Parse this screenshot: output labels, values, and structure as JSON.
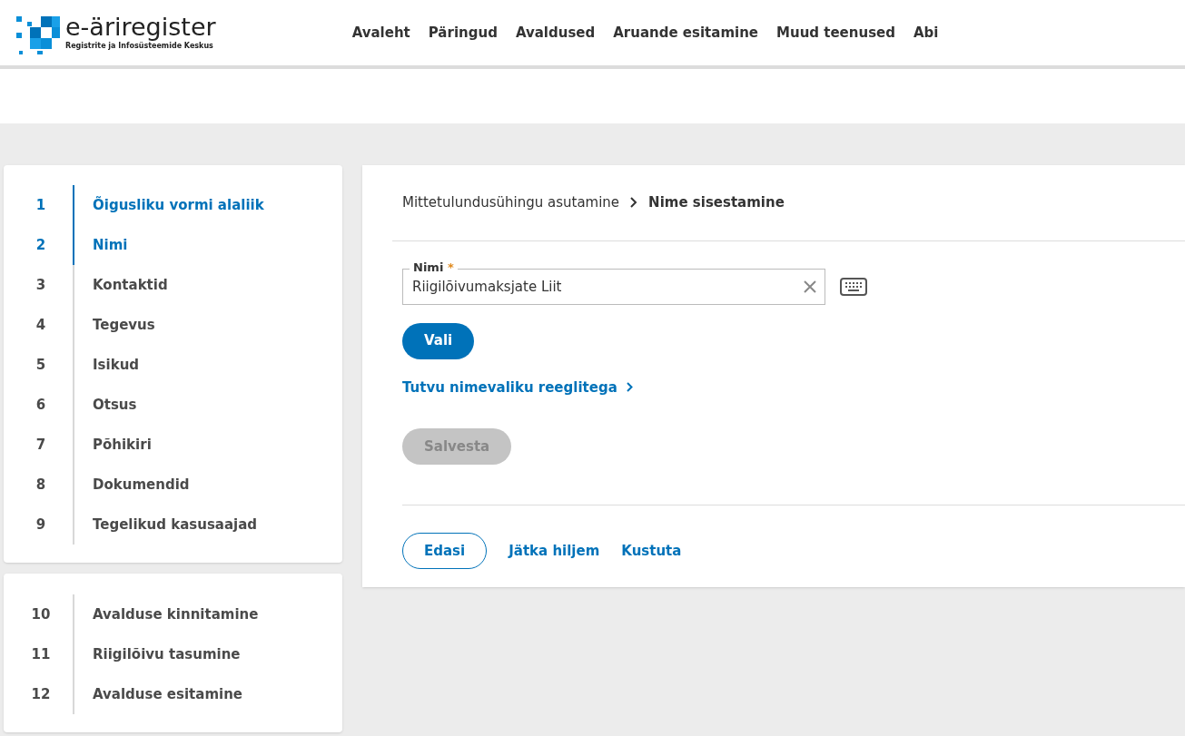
{
  "logo": {
    "name": "e-äriregister",
    "subtitle": "Registrite ja Infosüsteemide Keskus"
  },
  "nav": [
    "Avaleht",
    "Päringud",
    "Avaldused",
    "Aruande esitamine",
    "Muud teenused",
    "Abi"
  ],
  "steps": [
    {
      "number": "1",
      "label": "Õigusliku vormi alaliik",
      "highlighted": true
    },
    {
      "number": "2",
      "label": "Nimi",
      "highlighted": true
    },
    {
      "number": "3",
      "label": "Kontaktid",
      "highlighted": false
    },
    {
      "number": "4",
      "label": "Tegevus",
      "highlighted": false
    },
    {
      "number": "5",
      "label": "Isikud",
      "highlighted": false
    },
    {
      "number": "6",
      "label": "Otsus",
      "highlighted": false
    },
    {
      "number": "7",
      "label": "Põhikiri",
      "highlighted": false
    },
    {
      "number": "8",
      "label": "Dokumendid",
      "highlighted": false
    },
    {
      "number": "9",
      "label": "Tegelikud kasusaajad",
      "highlighted": false
    }
  ],
  "final_steps": [
    {
      "number": "10",
      "label": "Avalduse kinnitamine",
      "highlighted": false
    },
    {
      "number": "11",
      "label": "Riigilõivu tasumine",
      "highlighted": false
    },
    {
      "number": "12",
      "label": "Avalduse esitamine",
      "highlighted": false
    }
  ],
  "breadcrumb": [
    "Mittetulundusühingu asutamine",
    "Nime sisestamine"
  ],
  "name_field": {
    "label": "Nimi",
    "required_mark": "*",
    "value": "Riigilõivumaksjate Liit"
  },
  "select_button": {
    "label": "Vali",
    "disabled": false
  },
  "rules_link": "Tutvu nimevaliku reeglitega",
  "save_button": {
    "label": "Salvesta",
    "disabled": true
  },
  "footer_actions": [
    {
      "label": "Edasi",
      "kind": "outline"
    },
    {
      "label": "Jätka hiljem",
      "kind": "link"
    },
    {
      "label": "Kustuta",
      "kind": "link"
    }
  ]
}
